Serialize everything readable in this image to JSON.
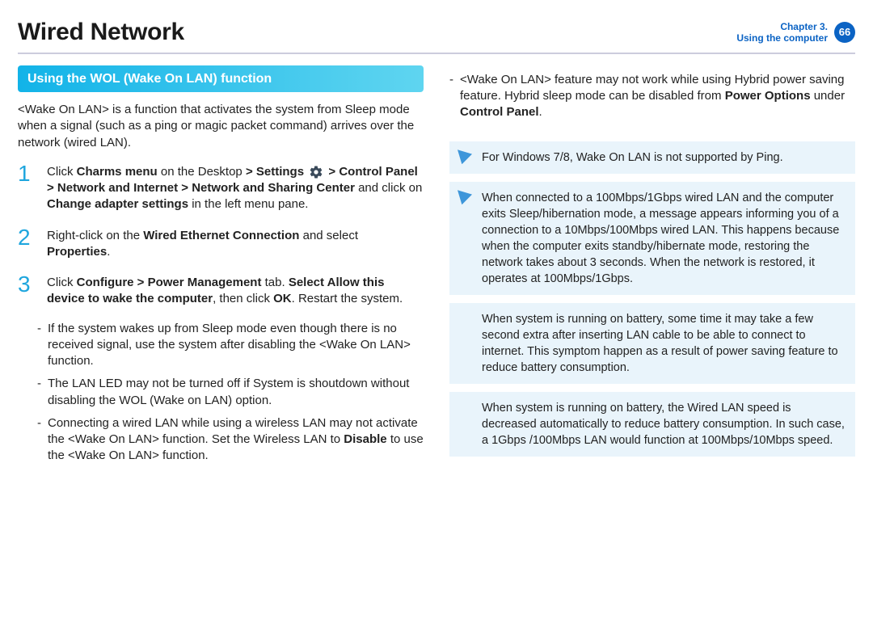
{
  "page_title": "Wired Network",
  "chapter_line1": "Chapter 3.",
  "chapter_line2": "Using the computer",
  "page_number": "66",
  "section_heading": "Using the WOL (Wake On LAN) function",
  "intro": "<Wake On LAN> is a function that activates the system from Sleep mode when a signal (such as a ping or magic packet command) arrives over the network (wired LAN).",
  "steps": [
    {
      "num": "1",
      "pre": "Click ",
      "b1": "Charms menu",
      "mid1": " on the Desktop ",
      "b2": "> Settings ",
      "icon": true,
      "mid2": " > ",
      "b3": "Control Panel > Network and Internet > Network and Sharing Center",
      "mid3": " and click on ",
      "b4": "Change adapter settings",
      "post": " in the left menu pane."
    },
    {
      "num": "2",
      "pre": "Right-click on the ",
      "b1": "Wired Ethernet Connection",
      "mid1": " and select ",
      "b2": "Properties",
      "post": "."
    },
    {
      "num": "3",
      "pre": "Click ",
      "b1": "Configure > Power Management",
      "mid1": " tab. ",
      "b2": "Select Allow this device to wake the computer",
      "mid2": ", then click ",
      "b3": "OK",
      "post": ". Restart the system."
    }
  ],
  "sub_bullets_col1": [
    "If the system wakes up from Sleep mode even though there is no received signal, use the system after disabling the <Wake On LAN> function.",
    "The LAN LED may not be turned off if System is shoutdown without disabling the WOL (Wake on LAN) option.",
    {
      "pre": "Connecting a wired LAN while using a wireless LAN may not activate the <Wake On LAN> function. Set the Wireless LAN to ",
      "b1": "Disable",
      "post": " to use the <Wake On LAN> function."
    }
  ],
  "col2_bullet": {
    "pre": "<Wake On LAN> feature may not work while using Hybrid power saving feature. Hybrid sleep mode can be disabled from ",
    "b1": "Power Options",
    "mid1": " under ",
    "b2": "Control Panel",
    "post": "."
  },
  "notes": [
    "For Windows 7/8, Wake On LAN is not supported by Ping.",
    "When connected to a 100Mbps/1Gbps wired LAN and the computer exits Sleep/hibernation mode, a message appears informing you of a connection to a 10Mbps/100Mbps wired LAN. This happens because when the computer exits standby/hibernate mode, restoring the network takes about 3 seconds. When the network is restored, it operates at 100Mbps/1Gbps.",
    "When system is running on battery, some time it may take a few second extra after inserting LAN cable to be able to connect to internet. This symptom happen as a result of power saving feature to reduce battery consumption.",
    "When system is running on battery, the Wired LAN speed is decreased automatically to reduce battery consumption. In such case, a 1Gbps /100Mbps LAN would function at 100Mbps/10Mbps speed."
  ]
}
